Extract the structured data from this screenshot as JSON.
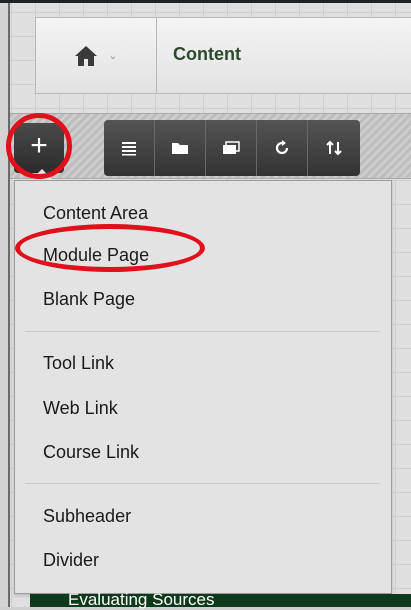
{
  "header": {
    "title": "Content",
    "home_icon": "home-icon"
  },
  "toolbar": {
    "add_symbol": "+",
    "buttons": [
      "list-view-icon",
      "folder-icon",
      "window-icon",
      "refresh-icon",
      "sort-icon"
    ]
  },
  "menu": {
    "items": [
      "Content Area",
      "Module Page",
      "Blank Page",
      "Tool Link",
      "Web Link",
      "Course Link",
      "Subheader",
      "Divider"
    ]
  },
  "annotation_color": "#e0101c",
  "footer": {
    "partial_text": "Evaluating Sources"
  }
}
